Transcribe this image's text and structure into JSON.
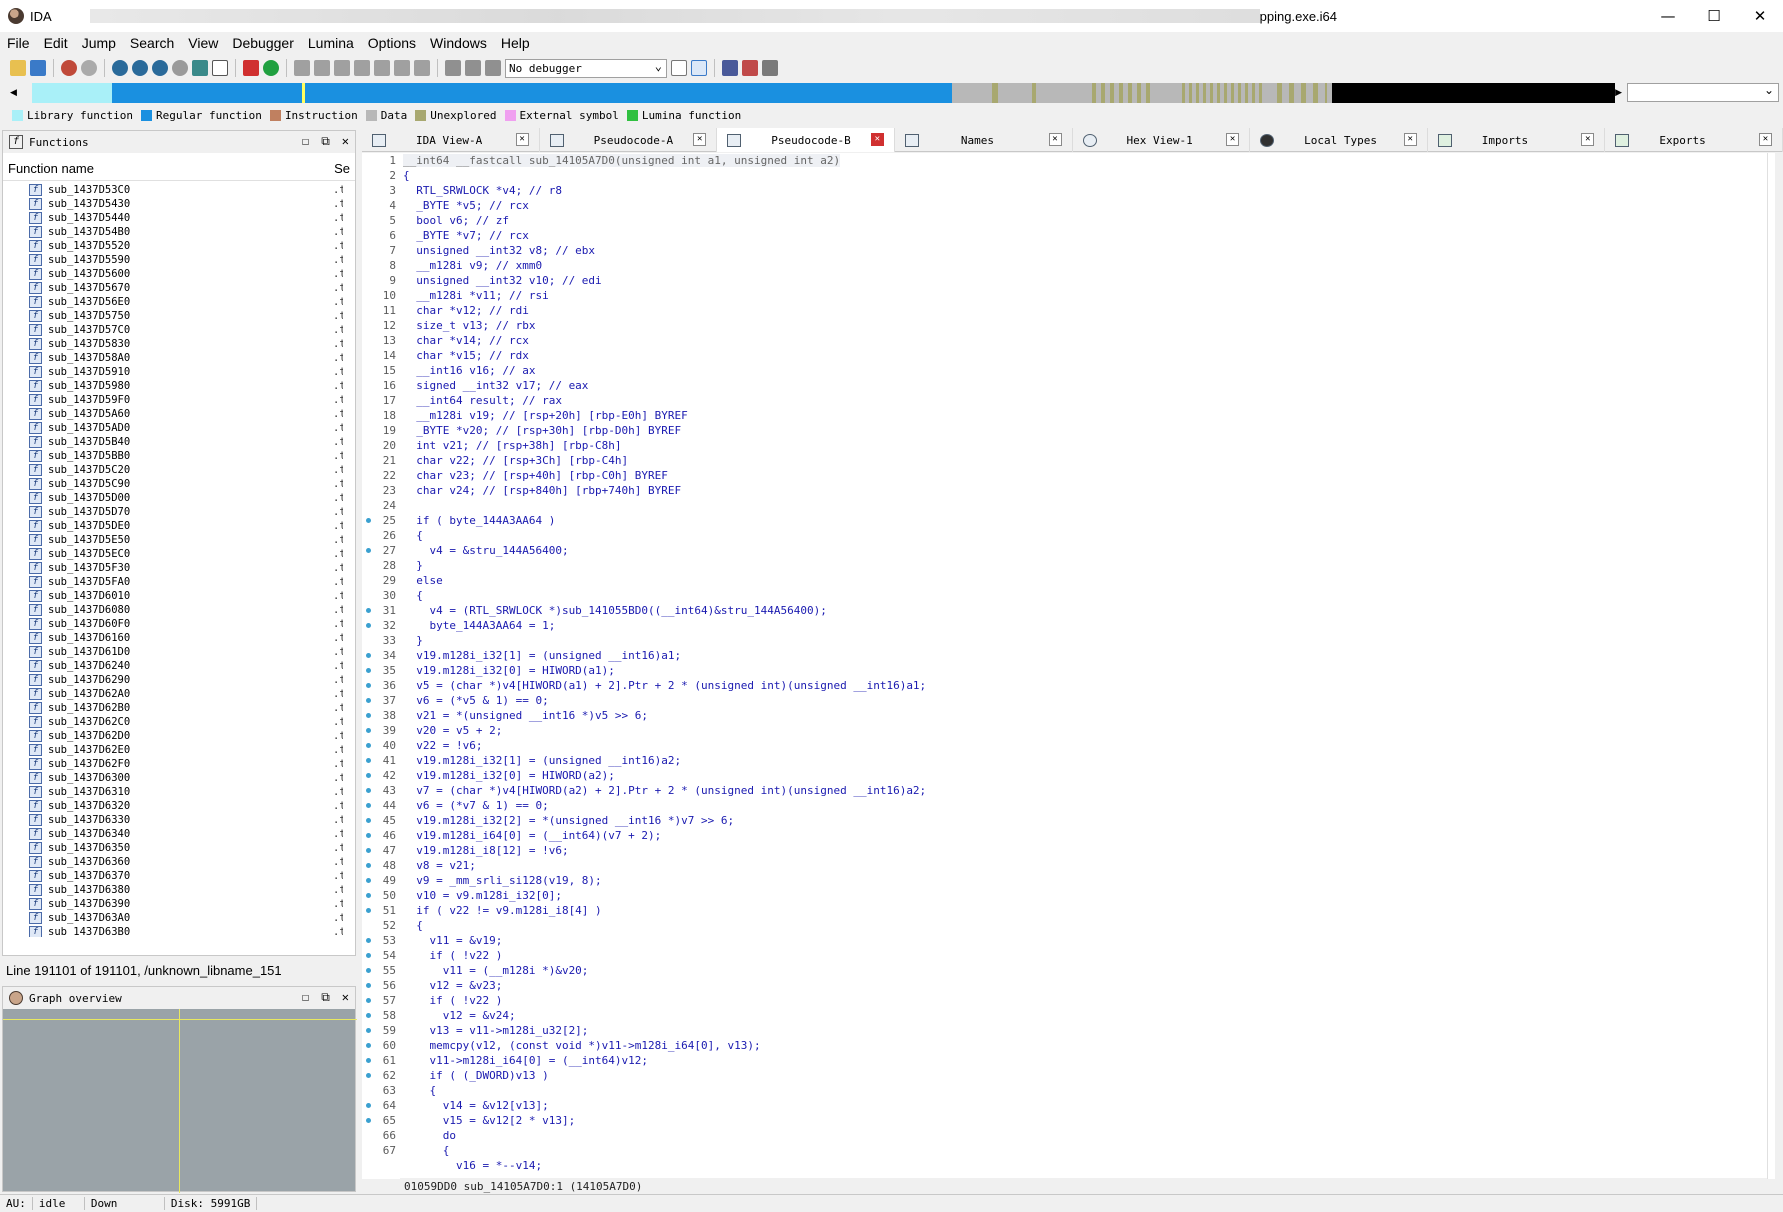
{
  "window": {
    "app_title": "IDA",
    "title_suffix": "pping.exe.i64",
    "controls": [
      "—",
      "☐",
      "✕"
    ]
  },
  "menu": [
    "File",
    "Edit",
    "Jump",
    "Search",
    "View",
    "Debugger",
    "Lumina",
    "Options",
    "Windows",
    "Help"
  ],
  "toolbar": {
    "debugger_select": "No debugger"
  },
  "legend": [
    {
      "label": "Library function",
      "color": "#a9f0f8"
    },
    {
      "label": "Regular function",
      "color": "#1a90e0"
    },
    {
      "label": "Instruction",
      "color": "#c08060"
    },
    {
      "label": "Data",
      "color": "#b8b8b8"
    },
    {
      "label": "Unexplored",
      "color": "#a8a870"
    },
    {
      "label": "External symbol",
      "color": "#f0a0f0"
    },
    {
      "label": "Lumina function",
      "color": "#30c040"
    }
  ],
  "functions_panel": {
    "title": "Functions",
    "col_name": "Function name",
    "col_segment": "Se",
    "segment_value": ".t",
    "items": [
      "sub_1437D53C0",
      "sub_1437D5430",
      "sub_1437D5440",
      "sub_1437D54B0",
      "sub_1437D5520",
      "sub_1437D5590",
      "sub_1437D5600",
      "sub_1437D5670",
      "sub_1437D56E0",
      "sub_1437D5750",
      "sub_1437D57C0",
      "sub_1437D5830",
      "sub_1437D58A0",
      "sub_1437D5910",
      "sub_1437D5980",
      "sub_1437D59F0",
      "sub_1437D5A60",
      "sub_1437D5AD0",
      "sub_1437D5B40",
      "sub_1437D5BB0",
      "sub_1437D5C20",
      "sub_1437D5C90",
      "sub_1437D5D00",
      "sub_1437D5D70",
      "sub_1437D5DE0",
      "sub_1437D5E50",
      "sub_1437D5EC0",
      "sub_1437D5F30",
      "sub_1437D5FA0",
      "sub_1437D6010",
      "sub_1437D6080",
      "sub_1437D60F0",
      "sub_1437D6160",
      "sub_1437D61D0",
      "sub_1437D6240",
      "sub_1437D6290",
      "sub_1437D62A0",
      "sub_1437D62B0",
      "sub_1437D62C0",
      "sub_1437D62D0",
      "sub_1437D62E0",
      "sub_1437D62F0",
      "sub_1437D6300",
      "sub_1437D6310",
      "sub_1437D6320",
      "sub_1437D6330",
      "sub_1437D6340",
      "sub_1437D6350",
      "sub_1437D6360",
      "sub_1437D6370",
      "sub_1437D6380",
      "sub_1437D6390",
      "sub_1437D63A0",
      "sub_1437D63B0"
    ],
    "status": "Line 191101 of 191101, /unknown_libname_151"
  },
  "graph_panel": {
    "title": "Graph overview"
  },
  "tabs": [
    {
      "label": "IDA View-A",
      "active": false
    },
    {
      "label": "Pseudocode-A",
      "active": false
    },
    {
      "label": "Pseudocode-B",
      "active": true
    },
    {
      "label": "Names",
      "active": false
    },
    {
      "label": "Hex View-1",
      "active": false
    },
    {
      "label": "Local Types",
      "active": false
    },
    {
      "label": "Imports",
      "active": false
    },
    {
      "label": "Exports",
      "active": false
    }
  ],
  "code": {
    "lines": [
      {
        "n": "1",
        "t": "__int64 __fastcall sub_14105A7D0(unsigned int a1, unsigned int a2)",
        "d": false
      },
      {
        "n": "2",
        "t": "{",
        "d": false
      },
      {
        "n": "3",
        "t": "  RTL_SRWLOCK *v4; // r8",
        "d": false
      },
      {
        "n": "4",
        "t": "  _BYTE *v5; // rcx",
        "d": false
      },
      {
        "n": "5",
        "t": "  bool v6; // zf",
        "d": false
      },
      {
        "n": "6",
        "t": "  _BYTE *v7; // rcx",
        "d": false
      },
      {
        "n": "7",
        "t": "  unsigned __int32 v8; // ebx",
        "d": false
      },
      {
        "n": "8",
        "t": "  __m128i v9; // xmm0",
        "d": false
      },
      {
        "n": "9",
        "t": "  unsigned __int32 v10; // edi",
        "d": false
      },
      {
        "n": "10",
        "t": "  __m128i *v11; // rsi",
        "d": false
      },
      {
        "n": "11",
        "t": "  char *v12; // rdi",
        "d": false
      },
      {
        "n": "12",
        "t": "  size_t v13; // rbx",
        "d": false
      },
      {
        "n": "13",
        "t": "  char *v14; // rcx",
        "d": false
      },
      {
        "n": "14",
        "t": "  char *v15; // rdx",
        "d": false
      },
      {
        "n": "15",
        "t": "  __int16 v16; // ax",
        "d": false
      },
      {
        "n": "16",
        "t": "  signed __int32 v17; // eax",
        "d": false
      },
      {
        "n": "17",
        "t": "  __int64 result; // rax",
        "d": false
      },
      {
        "n": "18",
        "t": "  __m128i v19; // [rsp+20h] [rbp-E0h] BYREF",
        "d": false
      },
      {
        "n": "19",
        "t": "  _BYTE *v20; // [rsp+30h] [rbp-D0h] BYREF",
        "d": false
      },
      {
        "n": "20",
        "t": "  int v21; // [rsp+38h] [rbp-C8h]",
        "d": false
      },
      {
        "n": "21",
        "t": "  char v22; // [rsp+3Ch] [rbp-C4h]",
        "d": false
      },
      {
        "n": "22",
        "t": "  char v23; // [rsp+40h] [rbp-C0h] BYREF",
        "d": false
      },
      {
        "n": "23",
        "t": "  char v24; // [rsp+840h] [rbp+740h] BYREF",
        "d": false
      },
      {
        "n": "24",
        "t": "",
        "d": false
      },
      {
        "n": "25",
        "t": "  if ( byte_144A3AA64 )",
        "d": true
      },
      {
        "n": "26",
        "t": "  {",
        "d": false
      },
      {
        "n": "27",
        "t": "    v4 = &stru_144A56400;",
        "d": true
      },
      {
        "n": "28",
        "t": "  }",
        "d": false
      },
      {
        "n": "29",
        "t": "  else",
        "d": false
      },
      {
        "n": "30",
        "t": "  {",
        "d": false
      },
      {
        "n": "31",
        "t": "    v4 = (RTL_SRWLOCK *)sub_141055BD0((__int64)&stru_144A56400);",
        "d": true
      },
      {
        "n": "32",
        "t": "    byte_144A3AA64 = 1;",
        "d": true
      },
      {
        "n": "33",
        "t": "  }",
        "d": false
      },
      {
        "n": "34",
        "t": "  v19.m128i_i32[1] = (unsigned __int16)a1;",
        "d": true
      },
      {
        "n": "35",
        "t": "  v19.m128i_i32[0] = HIWORD(a1);",
        "d": true
      },
      {
        "n": "36",
        "t": "  v5 = (char *)v4[HIWORD(a1) + 2].Ptr + 2 * (unsigned int)(unsigned __int16)a1;",
        "d": true
      },
      {
        "n": "37",
        "t": "  v6 = (*v5 & 1) == 0;",
        "d": true
      },
      {
        "n": "38",
        "t": "  v21 = *(unsigned __int16 *)v5 >> 6;",
        "d": true
      },
      {
        "n": "39",
        "t": "  v20 = v5 + 2;",
        "d": true
      },
      {
        "n": "40",
        "t": "  v22 = !v6;",
        "d": true
      },
      {
        "n": "41",
        "t": "  v19.m128i_i32[1] = (unsigned __int16)a2;",
        "d": true
      },
      {
        "n": "42",
        "t": "  v19.m128i_i32[0] = HIWORD(a2);",
        "d": true
      },
      {
        "n": "43",
        "t": "  v7 = (char *)v4[HIWORD(a2) + 2].Ptr + 2 * (unsigned int)(unsigned __int16)a2;",
        "d": true
      },
      {
        "n": "44",
        "t": "  v6 = (*v7 & 1) == 0;",
        "d": true
      },
      {
        "n": "45",
        "t": "  v19.m128i_i32[2] = *(unsigned __int16 *)v7 >> 6;",
        "d": true
      },
      {
        "n": "46",
        "t": "  v19.m128i_i64[0] = (__int64)(v7 + 2);",
        "d": true
      },
      {
        "n": "47",
        "t": "  v19.m128i_i8[12] = !v6;",
        "d": true
      },
      {
        "n": "48",
        "t": "  v8 = v21;",
        "d": true
      },
      {
        "n": "49",
        "t": "  v9 = _mm_srli_si128(v19, 8);",
        "d": true
      },
      {
        "n": "50",
        "t": "  v10 = v9.m128i_i32[0];",
        "d": true
      },
      {
        "n": "51",
        "t": "  if ( v22 != v9.m128i_i8[4] )",
        "d": true
      },
      {
        "n": "52",
        "t": "  {",
        "d": false
      },
      {
        "n": "53",
        "t": "    v11 = &v19;",
        "d": true
      },
      {
        "n": "54",
        "t": "    if ( !v22 )",
        "d": true
      },
      {
        "n": "55",
        "t": "      v11 = (__m128i *)&v20;",
        "d": true
      },
      {
        "n": "56",
        "t": "    v12 = &v23;",
        "d": true
      },
      {
        "n": "57",
        "t": "    if ( !v22 )",
        "d": true
      },
      {
        "n": "58",
        "t": "      v12 = &v24;",
        "d": true
      },
      {
        "n": "59",
        "t": "    v13 = v11->m128i_u32[2];",
        "d": true
      },
      {
        "n": "60",
        "t": "    memcpy(v12, (const void *)v11->m128i_i64[0], v13);",
        "d": true
      },
      {
        "n": "61",
        "t": "    v11->m128i_i64[0] = (__int64)v12;",
        "d": true
      },
      {
        "n": "62",
        "t": "    if ( (_DWORD)v13 )",
        "d": true
      },
      {
        "n": "63",
        "t": "    {",
        "d": false
      },
      {
        "n": "64",
        "t": "      v14 = &v12[v13];",
        "d": true
      },
      {
        "n": "65",
        "t": "      v15 = &v12[2 * v13];",
        "d": true
      },
      {
        "n": "66",
        "t": "      do",
        "d": false
      },
      {
        "n": "67",
        "t": "      {",
        "d": false
      },
      {
        "n": "",
        "t": "        v16 = *--v14;",
        "d": false
      }
    ],
    "footer": "01059DD0 sub_14105A7D0:1 (14105A7D0)"
  },
  "statusbar": {
    "au_label": "AU:",
    "au_state": "idle",
    "direction": "Down",
    "disk": "Disk: 5991GB"
  }
}
